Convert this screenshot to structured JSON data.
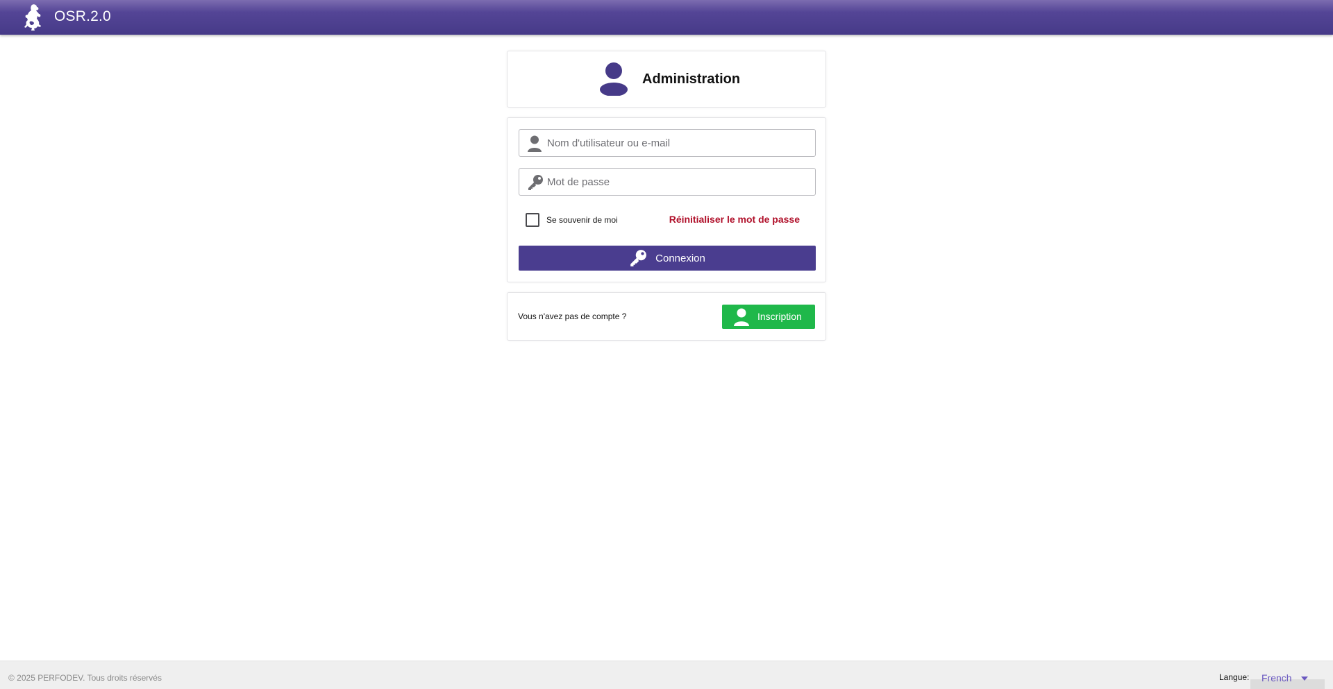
{
  "header": {
    "app_title": "OSR.2.0",
    "logo_icon": "lion-rampant-icon",
    "colors": {
      "bar": "#463a88"
    }
  },
  "admin_card": {
    "title": "Administration",
    "icon": "user-icon",
    "icon_color": "#463a88"
  },
  "login_form": {
    "username_placeholder": "Nom d'utilisateur ou e-mail",
    "username_value": "",
    "username_icon": "user-icon",
    "password_placeholder": "Mot de passe",
    "password_value": "",
    "password_icon": "key-icon",
    "remember_label": "Se souvenir de moi",
    "remember_checked": false,
    "reset_link": "Réinitialiser le mot de passe",
    "login_label": "Connexion",
    "login_icon": "key-icon",
    "colors": {
      "login_button": "#4a3d8f",
      "reset_link": "#b0102a"
    }
  },
  "register_card": {
    "question": "Vous n'avez pas de compte ?",
    "register_label": "Inscription",
    "register_icon": "user-icon",
    "colors": {
      "register_button": "#1fb84a"
    }
  },
  "footer": {
    "copyright": "© 2025 PERFODEV. Tous droits réservés",
    "language_label": "Langue:",
    "language_value": "French"
  }
}
